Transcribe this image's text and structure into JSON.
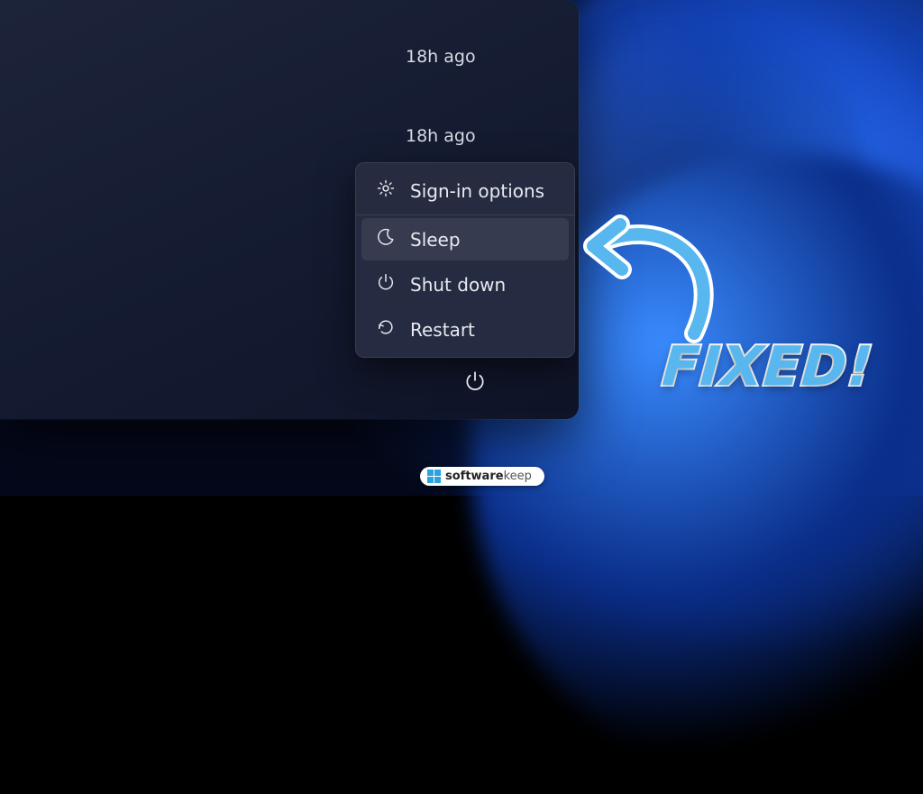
{
  "recent": {
    "time1": "18h ago",
    "time2": "18h ago"
  },
  "power_menu": {
    "signin": "Sign-in options",
    "sleep": "Sleep",
    "shutdown": "Shut down",
    "restart": "Restart"
  },
  "callout": {
    "text": "FIXED!"
  },
  "brand": {
    "name_bold": "software",
    "name_light": "keep"
  }
}
